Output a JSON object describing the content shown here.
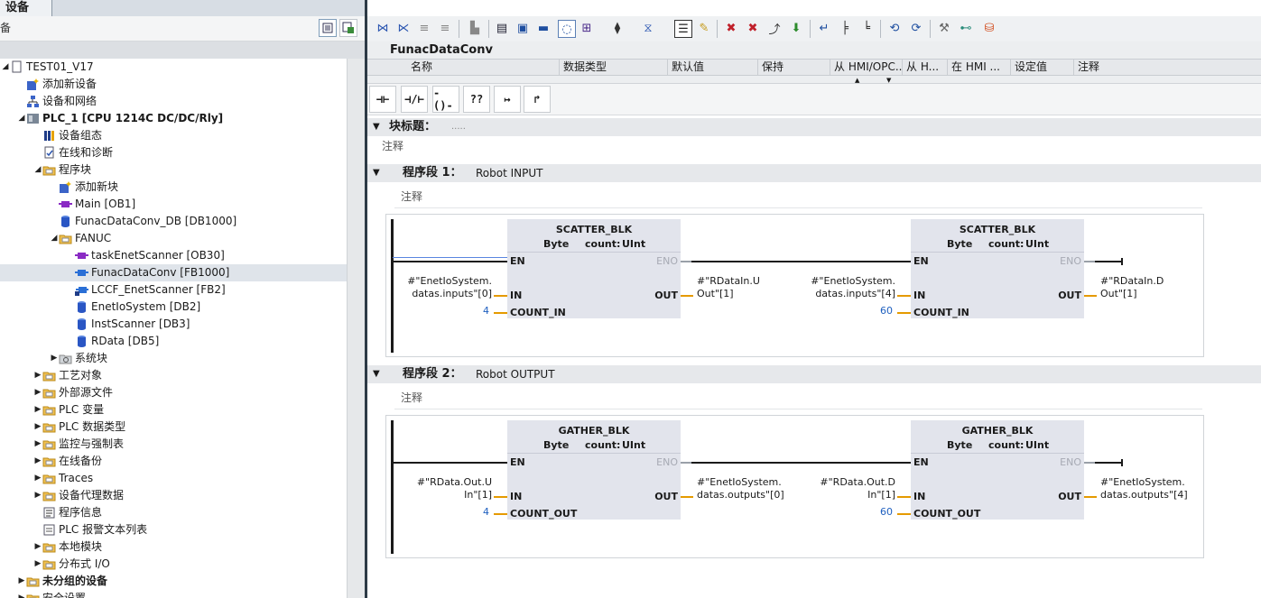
{
  "left": {
    "tab_label": "设备",
    "toolbar_label": "备",
    "tree": [
      {
        "label": "TEST01_V17",
        "indent": 0,
        "arrow": "◢",
        "icon": "doc",
        "bold": false
      },
      {
        "label": "添加新设备",
        "indent": 1,
        "arrow": "",
        "icon": "add-device",
        "bold": false
      },
      {
        "label": "设备和网络",
        "indent": 1,
        "arrow": "",
        "icon": "network",
        "bold": false
      },
      {
        "label": "PLC_1 [CPU 1214C DC/DC/Rly]",
        "indent": 1,
        "arrow": "◢",
        "icon": "cpu",
        "bold": true
      },
      {
        "label": "设备组态",
        "indent": 2,
        "arrow": "",
        "icon": "config",
        "bold": false
      },
      {
        "label": "在线和诊断",
        "indent": 2,
        "arrow": "",
        "icon": "diag",
        "bold": false
      },
      {
        "label": "程序块",
        "indent": 2,
        "arrow": "◢",
        "icon": "folder",
        "bold": false
      },
      {
        "label": "添加新块",
        "indent": 3,
        "arrow": "",
        "icon": "add-block",
        "bold": false
      },
      {
        "label": "Main [OB1]",
        "indent": 3,
        "arrow": "",
        "icon": "ob",
        "bold": false
      },
      {
        "label": "FunacDataConv_DB [DB1000]",
        "indent": 3,
        "arrow": "",
        "icon": "db",
        "bold": false
      },
      {
        "label": "FANUC",
        "indent": 3,
        "arrow": "◢",
        "icon": "folder",
        "bold": false
      },
      {
        "label": "taskEnetScanner [OB30]",
        "indent": 4,
        "arrow": "",
        "icon": "ob",
        "bold": false
      },
      {
        "label": "FunacDataConv [FB1000]",
        "indent": 4,
        "arrow": "",
        "icon": "fb",
        "bold": false,
        "selected": true
      },
      {
        "label": "LCCF_EnetScanner [FB2]",
        "indent": 4,
        "arrow": "",
        "icon": "fb-lock",
        "bold": false
      },
      {
        "label": "EnetIoSystem [DB2]",
        "indent": 4,
        "arrow": "",
        "icon": "db",
        "bold": false
      },
      {
        "label": "InstScanner [DB3]",
        "indent": 4,
        "arrow": "",
        "icon": "db",
        "bold": false
      },
      {
        "label": "RData [DB5]",
        "indent": 4,
        "arrow": "",
        "icon": "db",
        "bold": false
      },
      {
        "label": "系统块",
        "indent": 3,
        "arrow": "▶",
        "icon": "sysfolder",
        "bold": false
      },
      {
        "label": "工艺对象",
        "indent": 2,
        "arrow": "▶",
        "icon": "folder",
        "bold": false
      },
      {
        "label": "外部源文件",
        "indent": 2,
        "arrow": "▶",
        "icon": "folder",
        "bold": false
      },
      {
        "label": "PLC 变量",
        "indent": 2,
        "arrow": "▶",
        "icon": "folder",
        "bold": false
      },
      {
        "label": "PLC 数据类型",
        "indent": 2,
        "arrow": "▶",
        "icon": "folder",
        "bold": false
      },
      {
        "label": "监控与强制表",
        "indent": 2,
        "arrow": "▶",
        "icon": "folder",
        "bold": false
      },
      {
        "label": "在线备份",
        "indent": 2,
        "arrow": "▶",
        "icon": "folder",
        "bold": false
      },
      {
        "label": "Traces",
        "indent": 2,
        "arrow": "▶",
        "icon": "folder",
        "bold": false
      },
      {
        "label": "设备代理数据",
        "indent": 2,
        "arrow": "▶",
        "icon": "folder",
        "bold": false
      },
      {
        "label": "程序信息",
        "indent": 2,
        "arrow": "",
        "icon": "info",
        "bold": false
      },
      {
        "label": "PLC 报警文本列表",
        "indent": 2,
        "arrow": "",
        "icon": "alarm",
        "bold": false
      },
      {
        "label": "本地模块",
        "indent": 2,
        "arrow": "▶",
        "icon": "folder",
        "bold": false
      },
      {
        "label": "分布式 I/O",
        "indent": 2,
        "arrow": "▶",
        "icon": "folder",
        "bold": false
      },
      {
        "label": "未分组的设备",
        "indent": 1,
        "arrow": "▶",
        "icon": "folder",
        "bold": true
      },
      {
        "label": "安全设置",
        "indent": 1,
        "arrow": "▶",
        "icon": "folder",
        "bold": false
      }
    ]
  },
  "editor": {
    "block_name": "FunacDataConv",
    "interface_columns": [
      "名称",
      "数据类型",
      "默认值",
      "保持",
      "从 HMI/OPC...",
      "从 H...",
      "在 HMI ...",
      "设定值",
      "注释"
    ],
    "ladder_buttons": [
      "⊣⊢",
      "⊣/⊢",
      "-()-",
      "??",
      "↦",
      "↱"
    ],
    "block_title_label": "块标题：",
    "block_title_value": ".....",
    "comment_label": "注释",
    "networks": [
      {
        "title": "程序段 1：",
        "subtitle": "Robot INPUT",
        "comment": "注释",
        "boxes": [
          {
            "name": "SCATTER_BLK",
            "type": "Byte",
            "count_label": "count:",
            "count_type": "UInt",
            "en": "EN",
            "eno": "ENO",
            "in": "IN",
            "out": "OUT",
            "count_pin": "COUNT_IN",
            "in_operand_1": "#\"EnetIoSystem.",
            "in_operand_2": "datas.inputs\"[0]",
            "count_value": "4",
            "out_operand_1": "#\"RDataIn.U",
            "out_operand_2": "Out\"[1]"
          },
          {
            "name": "SCATTER_BLK",
            "type": "Byte",
            "count_label": "count:",
            "count_type": "UInt",
            "en": "EN",
            "eno": "ENO",
            "in": "IN",
            "out": "OUT",
            "count_pin": "COUNT_IN",
            "in_operand_1": "#\"EnetIoSystem.",
            "in_operand_2": "datas.inputs\"[4]",
            "count_value": "60",
            "out_operand_1": "#\"RDataIn.D",
            "out_operand_2": "Out\"[1]"
          }
        ]
      },
      {
        "title": "程序段 2：",
        "subtitle": "Robot OUTPUT",
        "comment": "注释",
        "boxes": [
          {
            "name": "GATHER_BLK",
            "type": "Byte",
            "count_label": "count:",
            "count_type": "UInt",
            "en": "EN",
            "eno": "ENO",
            "in": "IN",
            "out": "OUT",
            "count_pin": "COUNT_OUT",
            "in_operand_1": "#\"RData.Out.U",
            "in_operand_2": "In\"[1]",
            "count_value": "4",
            "out_operand_1": "#\"EnetIoSystem.",
            "out_operand_2": "datas.outputs\"[0]"
          },
          {
            "name": "GATHER_BLK",
            "type": "Byte",
            "count_label": "count:",
            "count_type": "UInt",
            "en": "EN",
            "eno": "ENO",
            "in": "IN",
            "out": "OUT",
            "count_pin": "COUNT_OUT",
            "in_operand_1": "#\"RData.Out.D",
            "in_operand_2": "In\"[1]",
            "count_value": "60",
            "out_operand_1": "#\"EnetIoSystem.",
            "out_operand_2": "datas.outputs\"[4]"
          }
        ]
      }
    ]
  },
  "colors": {
    "accent": "#e59a00",
    "selection": "#dfe4ea",
    "splitter": "#2d3a46",
    "constant": "#1e5fbf"
  }
}
